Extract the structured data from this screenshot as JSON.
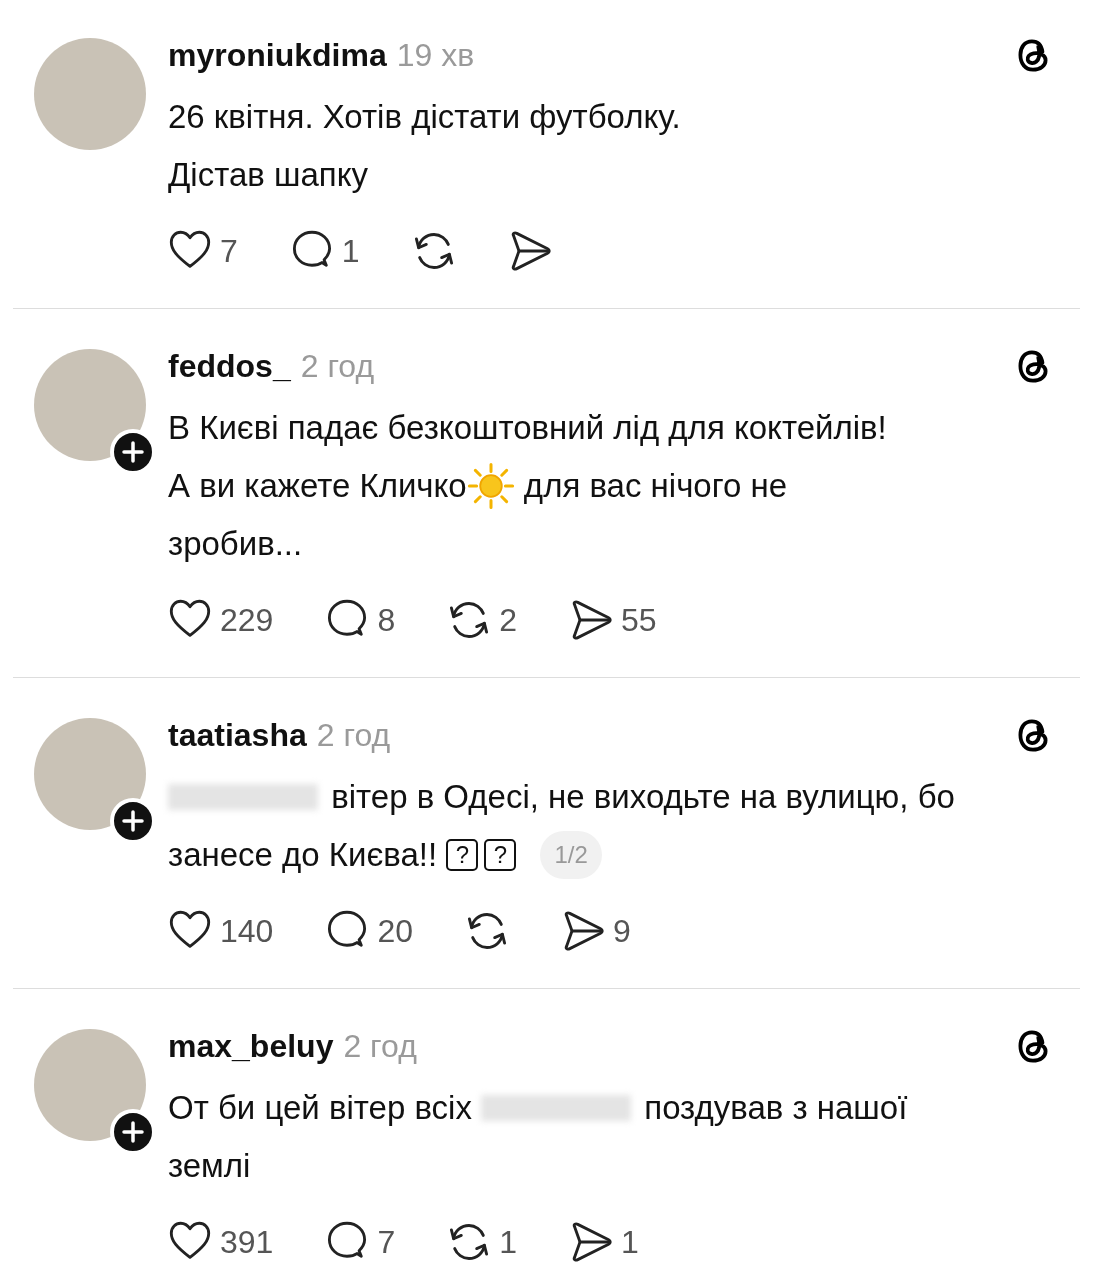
{
  "posts": [
    {
      "username": "myroniukdima",
      "time": "19 хв",
      "follow_badge": false,
      "text": [
        [
          {
            "kind": "text",
            "text": "26 квітня. Хотів дістати футболку."
          }
        ],
        [
          {
            "kind": "text",
            "text": "Дістав шапку"
          }
        ]
      ],
      "actions": [
        {
          "kind": "like",
          "count": "7"
        },
        {
          "kind": "reply",
          "count": "1"
        },
        {
          "kind": "repost"
        },
        {
          "kind": "share"
        }
      ]
    },
    {
      "username": "feddos_",
      "time": "2 год",
      "follow_badge": true,
      "text": [
        [
          {
            "kind": "text",
            "text": "В Києві падає безкоштовний лід для коктейлів!"
          }
        ],
        [
          {
            "kind": "text",
            "text": "А ви кажете Кличко"
          },
          {
            "kind": "sun"
          },
          {
            "kind": "text",
            "text": " для вас нічого не"
          }
        ],
        [
          {
            "kind": "text",
            "text": "зробив..."
          }
        ]
      ],
      "actions": [
        {
          "kind": "like",
          "count": "229"
        },
        {
          "kind": "reply",
          "count": "8"
        },
        {
          "kind": "repost",
          "count": "2"
        },
        {
          "kind": "share",
          "count": "55"
        }
      ]
    },
    {
      "username": "taatiasha",
      "time": "2 год",
      "follow_badge": true,
      "text": [
        [
          {
            "kind": "redacted"
          },
          {
            "kind": "text",
            "text": " вітер в Одесі, не виходьте на вулицю, бо"
          }
        ],
        [
          {
            "kind": "text",
            "text": "занесе до Києва!! "
          },
          {
            "kind": "glyph",
            "text": "?"
          },
          {
            "kind": "glyph",
            "text": "?"
          },
          {
            "kind": "pager",
            "text": "1/2"
          }
        ]
      ],
      "actions": [
        {
          "kind": "like",
          "count": "140"
        },
        {
          "kind": "reply",
          "count": "20"
        },
        {
          "kind": "repost"
        },
        {
          "kind": "share",
          "count": "9"
        }
      ]
    },
    {
      "username": "max_beluy",
      "time": "2 год",
      "follow_badge": true,
      "text": [
        [
          {
            "kind": "text",
            "text": "От би цей вітер всіх "
          },
          {
            "kind": "redacted"
          },
          {
            "kind": "text",
            "text": " поздував з нашої"
          }
        ],
        [
          {
            "kind": "text",
            "text": "землі"
          }
        ]
      ],
      "actions": [
        {
          "kind": "like",
          "count": "391"
        },
        {
          "kind": "reply",
          "count": "7"
        },
        {
          "kind": "repost",
          "count": "1"
        },
        {
          "kind": "share",
          "count": "1"
        }
      ]
    }
  ]
}
